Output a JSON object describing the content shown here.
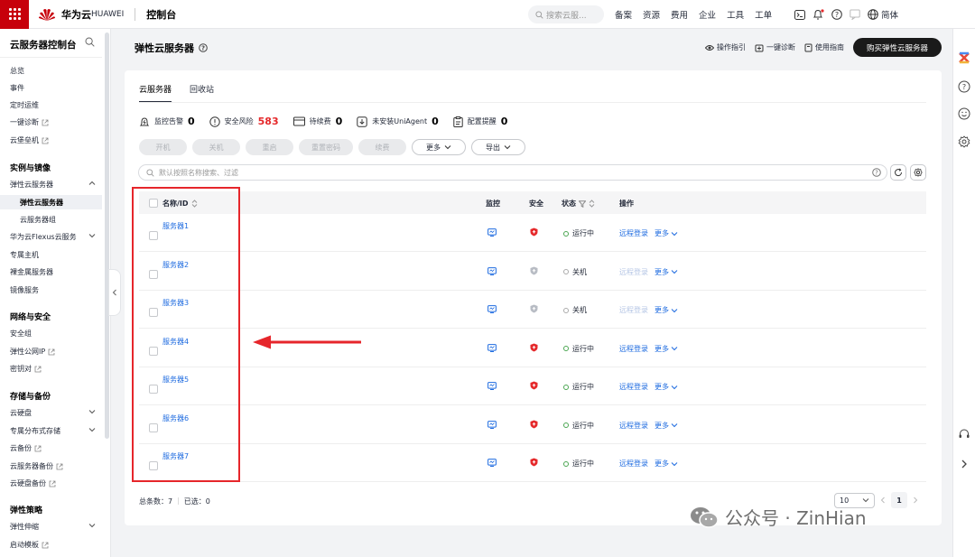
{
  "topbar": {
    "brand": "华为云",
    "brand_sub": "HUAWEI",
    "console": "控制台",
    "search_placeholder": "搜索云服...",
    "nav": [
      "备案",
      "资源",
      "费用",
      "企业",
      "工具",
      "工单"
    ],
    "lang": "简体",
    "accent": "#c7000b"
  },
  "sidebar": {
    "title": "云服务器控制台",
    "items": [
      {
        "label": "总览"
      },
      {
        "label": "事件"
      },
      {
        "label": "定时运维"
      },
      {
        "label": "一键诊断"
      },
      {
        "label": "云堡垒机"
      }
    ],
    "group1": "实例与镜像",
    "ecs": "弹性云服务器",
    "ecs_sub": "弹性云服务器",
    "ecs_group": "云服务器组",
    "flexus": "华为云Flexus云服务",
    "dedicated": "专属主机",
    "bms": "裸金属服务器",
    "ims": "镜像服务",
    "group2": "网络与安全",
    "sg": "安全组",
    "eip": "弹性公网IP",
    "keypair": "密钥对",
    "group3": "存储与备份",
    "evs": "云硬盘",
    "sfs": "专属分布式存储",
    "cbr": "云备份",
    "csbs": "云服务器备份",
    "vbs": "云硬盘备份",
    "group4": "弹性策略",
    "as": "弹性伸缩",
    "template": "启动模板"
  },
  "header": {
    "title": "弹性云服务器",
    "guide": "操作指引",
    "diagnose": "一键诊断",
    "manual": "使用指南",
    "buy": "购买弹性云服务器"
  },
  "tabs": [
    "云服务器",
    "回收站"
  ],
  "stats": [
    {
      "label": "监控告警",
      "value": "0"
    },
    {
      "label": "安全风险",
      "value": "583"
    },
    {
      "label": "待续费",
      "value": "0"
    },
    {
      "label": "未安装UniAgent",
      "value": "0"
    },
    {
      "label": "配置提醒",
      "value": "0"
    }
  ],
  "actions": {
    "start": "开机",
    "stop": "关机",
    "restart": "重启",
    "reset_pwd": "重置密码",
    "renew": "续费",
    "more": "更多",
    "export": "导出"
  },
  "filter_placeholder": "默认按照名称搜索、过滤",
  "table": {
    "headers": {
      "name": "名称/ID",
      "monitor": "监控",
      "security": "安全",
      "status": "状态",
      "ops": "操作"
    },
    "login": "远程登录",
    "more": "更多",
    "rows": [
      {
        "name": "服务器1",
        "status": "运行中"
      },
      {
        "name": "服务器2",
        "status": "关机"
      },
      {
        "name": "服务器3",
        "status": "关机"
      },
      {
        "name": "服务器4",
        "status": "运行中"
      },
      {
        "name": "服务器5",
        "status": "运行中"
      },
      {
        "name": "服务器6",
        "status": "运行中"
      },
      {
        "name": "服务器7",
        "status": "运行中"
      }
    ]
  },
  "footer": {
    "total": "总条数：7",
    "selected": "已选：0",
    "page_size": "10",
    "page": "1"
  },
  "watermark": "公众号 · ZinHian",
  "colors": {
    "link": "#1e6be0",
    "running": "#4aa651",
    "danger": "#e5292b",
    "highlight": "#e6262b"
  }
}
